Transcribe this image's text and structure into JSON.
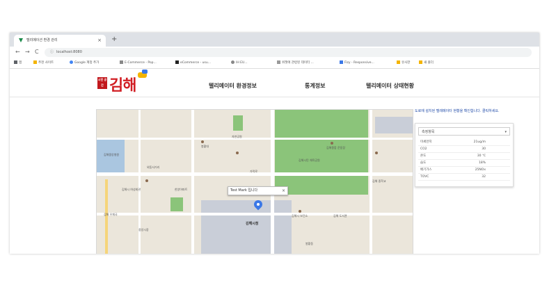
{
  "browser": {
    "tab_title": "텔리메이션 환경 관리",
    "tab_close": "×",
    "new_tab": "+",
    "back": "←",
    "forward": "→",
    "reload": "C",
    "url": "localhost:8080"
  },
  "bookmarks": [
    {
      "label": "앱",
      "color": "#5f6368"
    },
    {
      "label": "추천 사이트",
      "color": "#f4b400"
    },
    {
      "label": "Google 계정 추가",
      "color": "#4285f4"
    },
    {
      "label": "E-Commerce - Pop...",
      "color": "#555555"
    },
    {
      "label": "eCommerce - usu...",
      "color": "#222222"
    },
    {
      "label": "IH EU...",
      "color": "#555555"
    },
    {
      "label": "위젯에 관련된 데이터 ...",
      "color": "#555555"
    },
    {
      "label": "Fizy - Responsive...",
      "color": "#3b78e7"
    },
    {
      "label": "유사한",
      "color": "#f4b400"
    },
    {
      "label": "새 폴더",
      "color": "#f4b400"
    }
  ],
  "site": {
    "logo_badge": "시민 공간",
    "logo_text": "김해",
    "menu": [
      "텔리메이터 환경정보",
      "통계정보",
      "텔리메이터 상태현황"
    ]
  },
  "map": {
    "tooltip": "Test Mark 입니다",
    "tooltip_close": "×",
    "labels": [
      "김해시청",
      "김해시민 체육공원",
      "김해종합 운동장",
      "봉황대",
      "김해중앙병원",
      "외동사거리",
      "김해시 여성회관",
      "한양아파트",
      "가락로",
      "김해시 보건소",
      "김해 도서관",
      "중앙시장",
      "봉황동",
      "김해 우체국",
      "자연공원",
      "김해 중학교"
    ]
  },
  "side_panel": {
    "note": "도로에 설치된 텔레메이터 현황을 확인합니다. 클릭하세요.",
    "select_placeholder": "측정항목",
    "caret": "▾",
    "rows": [
      {
        "k": "미세먼지",
        "v": "21ug/m"
      },
      {
        "k": "CO2",
        "v": "30"
      },
      {
        "k": "온도",
        "v": "30 ℃"
      },
      {
        "k": "습도",
        "v": "18%"
      },
      {
        "k": "배기가스",
        "v": "25NOx"
      },
      {
        "k": "TOVC",
        "v": "32"
      }
    ]
  }
}
